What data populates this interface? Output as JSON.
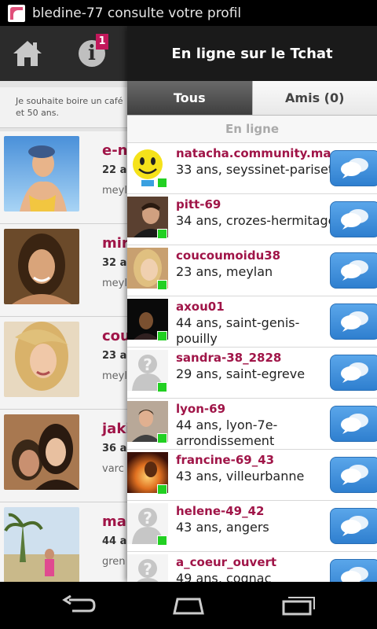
{
  "status_bar": {
    "notification_text": "bledine-77 consulte votre profil"
  },
  "left_page": {
    "info_badge": "1",
    "wish_text_line1": "Je souhaite boire un café",
    "wish_text_line2": "et 50 ans.",
    "profiles": [
      {
        "name": "e-n",
        "age": "22 a",
        "city": "meyl"
      },
      {
        "name": "mir",
        "age": "32 a",
        "city": "meyl"
      },
      {
        "name": "cou",
        "age": "23 a",
        "city": "meyl"
      },
      {
        "name": "jaki",
        "age": "36 a",
        "city": "varc"
      },
      {
        "name": "mar",
        "age": "44 a",
        "city": "gren"
      }
    ]
  },
  "chat_panel": {
    "title": "En ligne sur le Tchat",
    "tabs": [
      {
        "label": "Tous",
        "active": true
      },
      {
        "label": "Amis (0)",
        "active": false
      }
    ],
    "section_label": "En ligne",
    "users": [
      {
        "name": "natacha.community.ma...",
        "info": "33 ans, seyssinet-pariset",
        "avatar": "smiley"
      },
      {
        "name": "pitt-69",
        "info": "34 ans, crozes-hermitage",
        "avatar": "photo"
      },
      {
        "name": "coucoumoidu38",
        "info": "23 ans, meylan",
        "avatar": "photo"
      },
      {
        "name": "axou01",
        "info": "44 ans, saint-genis-pouilly",
        "avatar": "photo"
      },
      {
        "name": "sandra-38_2828",
        "info": "29 ans, saint-egreve",
        "avatar": "placeholder"
      },
      {
        "name": "lyon-69",
        "info": "44 ans, lyon-7e-arrondissement",
        "avatar": "photo"
      },
      {
        "name": "francine-69_43",
        "info": "43 ans, villeurbanne",
        "avatar": "photo"
      },
      {
        "name": "helene-49_42",
        "info": "43 ans, angers",
        "avatar": "placeholder"
      },
      {
        "name": "a_coeur_ouvert",
        "info": "49 ans, cognac",
        "avatar": "placeholder"
      }
    ]
  },
  "colors": {
    "accent": "#a01548",
    "online": "#22d022",
    "chat_button": "#3b8fdc",
    "header": "#1a1a1a"
  },
  "icons": {
    "home": "home-icon",
    "info": "info-icon",
    "chat": "speech-bubbles-icon",
    "back": "back-icon",
    "home_nav": "home-nav-icon",
    "recents": "recent-apps-icon"
  }
}
